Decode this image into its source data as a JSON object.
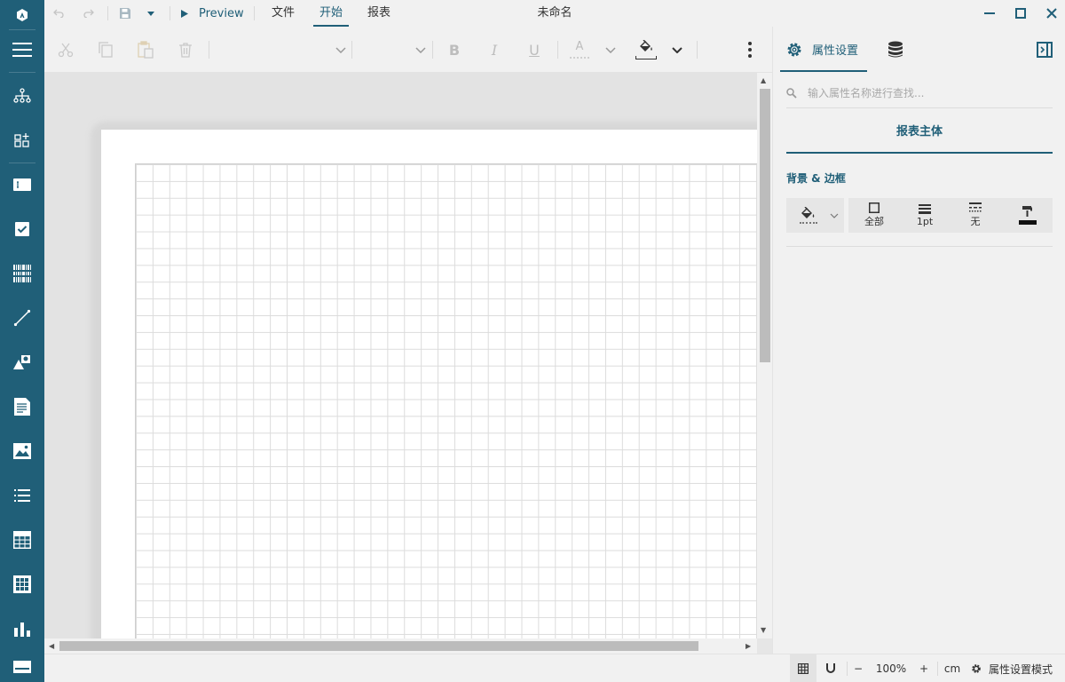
{
  "window": {
    "title": "未命名",
    "accent": "#205f78"
  },
  "quick_access": {
    "preview_label": "Preview"
  },
  "menu": {
    "tabs": [
      {
        "label": "文件"
      },
      {
        "label": "开始",
        "active": true
      },
      {
        "label": "报表"
      }
    ]
  },
  "toolbar": {
    "bold_glyph": "B",
    "italic_glyph": "I",
    "underline_glyph": "U",
    "font_color_glyph": "A"
  },
  "sidebar": {
    "items": [
      {
        "icon": "menu-icon"
      },
      {
        "icon": "report-explorer-icon"
      },
      {
        "icon": "group-editor-icon"
      },
      {
        "icon": "textbox-icon"
      },
      {
        "icon": "checkbox-icon"
      },
      {
        "icon": "barcode-icon"
      },
      {
        "icon": "line-icon"
      },
      {
        "icon": "shape-icon"
      },
      {
        "icon": "richtext-icon"
      },
      {
        "icon": "image-icon"
      },
      {
        "icon": "list-icon"
      },
      {
        "icon": "table-icon"
      },
      {
        "icon": "matrix-icon"
      },
      {
        "icon": "chart-icon"
      },
      {
        "icon": "banded-list-icon"
      }
    ]
  },
  "panel": {
    "tabs": [
      {
        "label": "属性设置",
        "icon": "gear-icon",
        "active": true
      },
      {
        "label": "",
        "icon": "database-icon"
      }
    ],
    "search_placeholder": "输入属性名称进行查找...",
    "section_title": "报表主体",
    "group_title": "背景 & 边框",
    "border": {
      "scope_label": "全部",
      "width_label": "1pt",
      "style_label": "无"
    }
  },
  "statusbar": {
    "zoom": "100%",
    "unit": "cm",
    "mode_label": "属性设置模式",
    "zoom_out": "−",
    "zoom_in": "+"
  }
}
